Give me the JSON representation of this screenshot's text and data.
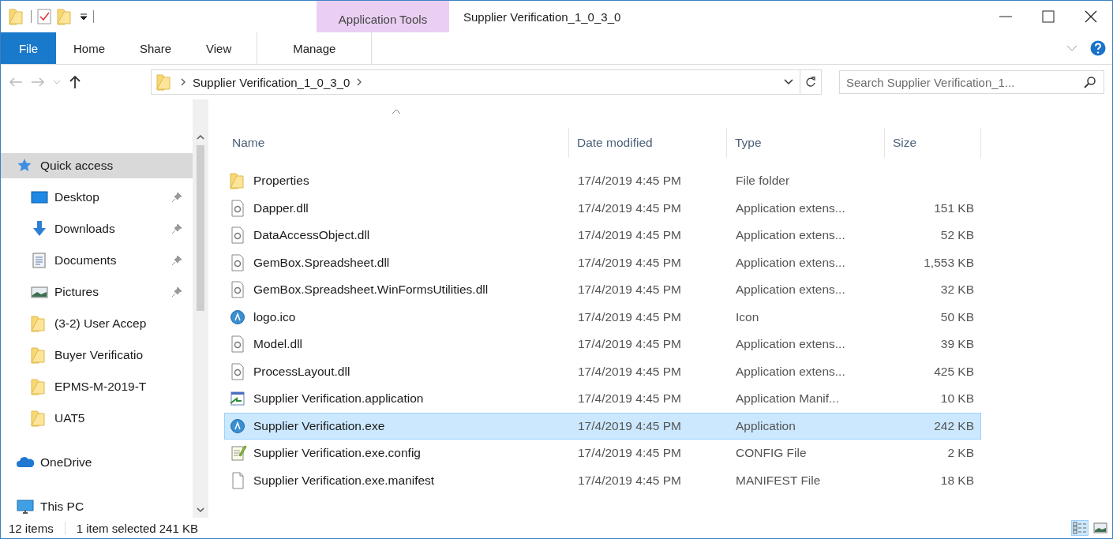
{
  "window": {
    "title": "Supplier Verification_1_0_3_0"
  },
  "ribbon": {
    "contextual_label": "Application Tools",
    "tabs": [
      {
        "label": "File",
        "kind": "file"
      },
      {
        "label": "Home",
        "kind": "normal"
      },
      {
        "label": "Share",
        "kind": "normal"
      },
      {
        "label": "View",
        "kind": "normal"
      },
      {
        "label": "Manage",
        "kind": "contextual"
      }
    ]
  },
  "address": {
    "segments": [
      "Supplier Verification_1_0_3_0"
    ],
    "search_placeholder": "Search Supplier Verification_1..."
  },
  "navigation": [
    {
      "label": "Quick access",
      "kind": "star",
      "selected": true,
      "children": [
        {
          "label": "Desktop",
          "kind": "desktop",
          "pinned": true,
          "selected": false
        },
        {
          "label": "Downloads",
          "kind": "download",
          "pinned": true,
          "selected": false
        },
        {
          "label": "Documents",
          "kind": "documents",
          "pinned": true,
          "selected": false
        },
        {
          "label": "Pictures",
          "kind": "pictures",
          "pinned": true,
          "selected": false
        },
        {
          "label": "(3-2) User Accep",
          "kind": "folder",
          "pinned": false,
          "selected": false
        },
        {
          "label": "Buyer Verificatio",
          "kind": "folder",
          "pinned": false,
          "selected": false
        },
        {
          "label": "EPMS-M-2019-T",
          "kind": "folder",
          "pinned": false,
          "selected": false
        },
        {
          "label": "UAT5",
          "kind": "folder",
          "pinned": false,
          "selected": false
        }
      ]
    },
    {
      "label": "OneDrive",
      "kind": "cloud",
      "selected": false
    },
    {
      "label": "This PC",
      "kind": "pc",
      "selected": false
    }
  ],
  "file_list": {
    "columns": [
      {
        "label": "Name",
        "sorted": true
      },
      {
        "label": "Date modified",
        "sorted": false
      },
      {
        "label": "Type",
        "sorted": false
      },
      {
        "label": "Size",
        "sorted": false
      }
    ],
    "rows": [
      {
        "name": "Properties",
        "kind": "folder",
        "date": "17/4/2019 4:45 PM",
        "type": "File folder",
        "size": "",
        "selected": false
      },
      {
        "name": "Dapper.dll",
        "kind": "dll",
        "date": "17/4/2019 4:45 PM",
        "type": "Application extens...",
        "size": "151 KB",
        "selected": false
      },
      {
        "name": "DataAccessObject.dll",
        "kind": "dll",
        "date": "17/4/2019 4:45 PM",
        "type": "Application extens...",
        "size": "52 KB",
        "selected": false
      },
      {
        "name": "GemBox.Spreadsheet.dll",
        "kind": "dll",
        "date": "17/4/2019 4:45 PM",
        "type": "Application extens...",
        "size": "1,553 KB",
        "selected": false
      },
      {
        "name": "GemBox.Spreadsheet.WinFormsUtilities.dll",
        "kind": "dll",
        "date": "17/4/2019 4:45 PM",
        "type": "Application extens...",
        "size": "32 KB",
        "selected": false
      },
      {
        "name": "logo.ico",
        "kind": "app",
        "date": "17/4/2019 4:45 PM",
        "type": "Icon",
        "size": "50 KB",
        "selected": false
      },
      {
        "name": "Model.dll",
        "kind": "dll",
        "date": "17/4/2019 4:45 PM",
        "type": "Application extens...",
        "size": "39 KB",
        "selected": false
      },
      {
        "name": "ProcessLayout.dll",
        "kind": "dll",
        "date": "17/4/2019 4:45 PM",
        "type": "Application extens...",
        "size": "425 KB",
        "selected": false
      },
      {
        "name": "Supplier Verification.application",
        "kind": "shortcut",
        "date": "17/4/2019 4:45 PM",
        "type": "Application Manif...",
        "size": "10 KB",
        "selected": false
      },
      {
        "name": "Supplier Verification.exe",
        "kind": "app",
        "date": "17/4/2019 4:45 PM",
        "type": "Application",
        "size": "242 KB",
        "selected": true
      },
      {
        "name": "Supplier Verification.exe.config",
        "kind": "config",
        "date": "17/4/2019 4:45 PM",
        "type": "CONFIG File",
        "size": "2 KB",
        "selected": false
      },
      {
        "name": "Supplier Verification.exe.manifest",
        "kind": "blank",
        "date": "17/4/2019 4:45 PM",
        "type": "MANIFEST File",
        "size": "18 KB",
        "selected": false
      }
    ]
  },
  "status_bar": {
    "item_count": "12 items",
    "selection": "1 item selected 241 KB",
    "views": [
      {
        "kind": "details",
        "selected": true
      },
      {
        "kind": "large-icons",
        "selected": false
      }
    ]
  }
}
